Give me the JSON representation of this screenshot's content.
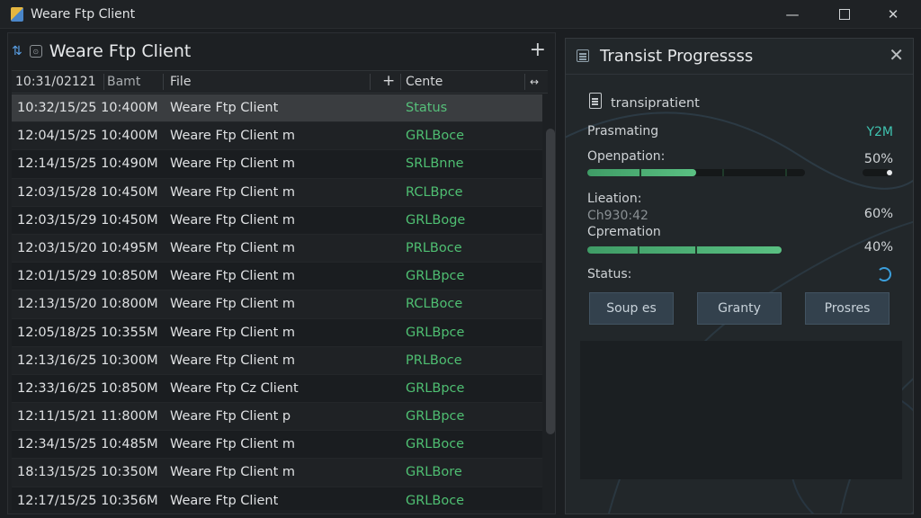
{
  "window": {
    "title": "Weare Ftp Client"
  },
  "left_panel": {
    "title": "Weare Ftp Client",
    "columns": [
      "10:31/02121",
      "Bamt",
      "File",
      "+",
      "Cente",
      "↔"
    ],
    "rows": [
      {
        "date": "10:32/15/25  10:400M",
        "file": "Weare Ftp Client",
        "status": "Status",
        "selected": true
      },
      {
        "date": "12:04/15/25  10:400M",
        "file": "Weare Ftp Client m",
        "status": "GRLBoce"
      },
      {
        "date": "12:14/15/25  10:490M",
        "file": "Weare Ftp Client m",
        "status": "SRLBnne"
      },
      {
        "date": "12:03/15/28  10:450M",
        "file": "Weare Ftp Client m",
        "status": "RCLBpce"
      },
      {
        "date": "12:03/15/29  10:450M",
        "file": "Weare Ftp Client m",
        "status": "GRLBoge"
      },
      {
        "date": "12:03/15/20  10:495M",
        "file": "Weare Ftp Client m",
        "status": "PRLBoce"
      },
      {
        "date": "12:01/15/29  10:850M",
        "file": "Weare Ftp Client m",
        "status": "GRLBpce"
      },
      {
        "date": "12:13/15/20  10:800M",
        "file": "Weare Ftp Client m",
        "status": "RCLBoce"
      },
      {
        "date": "12:05/18/25  10:355M",
        "file": "Weare Ftp Client m",
        "status": "GRLBpce"
      },
      {
        "date": "12:13/16/25  10:300M",
        "file": "Weare Ftp Client m",
        "status": "PRLBoce"
      },
      {
        "date": "12:33/16/25  10:850M",
        "file": "Weare Ftp Cz Client",
        "status": "GRLBpce"
      },
      {
        "date": "12:11/15/21  11:800M",
        "file": "Weare Ftp Client p",
        "status": "GRLBpce"
      },
      {
        "date": "12:34/15/25  10:485M",
        "file": "Weare Ftp Client m",
        "status": "GRLBoce"
      },
      {
        "date": "18:13/15/25  10:350M",
        "file": "Weare Ftp Client m",
        "status": "GRLBore"
      },
      {
        "date": "12:17/15/25  10:356M",
        "file": "Weare Ftp Client",
        "status": "GRLBoce"
      }
    ]
  },
  "right_panel": {
    "title": "Transist Progressss",
    "file_label": "transipratient",
    "processing_label": "Prasmating",
    "processing_value": "Y2M",
    "operation_label": "Openpation:",
    "operation_value": "50%",
    "operation_progress": 0.5,
    "location_label": "Lieation:",
    "location_value": "Ch930:42",
    "cpremation_label": "Cpremation",
    "cpremation_value": "60%",
    "cpremation_value2": "40%",
    "cpremation_progress": 0.4,
    "status_label": "Status:",
    "buttons": [
      "Soup es",
      "Granty",
      "Prosres"
    ]
  },
  "colors": {
    "accent_green": "#52c57d",
    "panel_bg": "#22272a"
  }
}
